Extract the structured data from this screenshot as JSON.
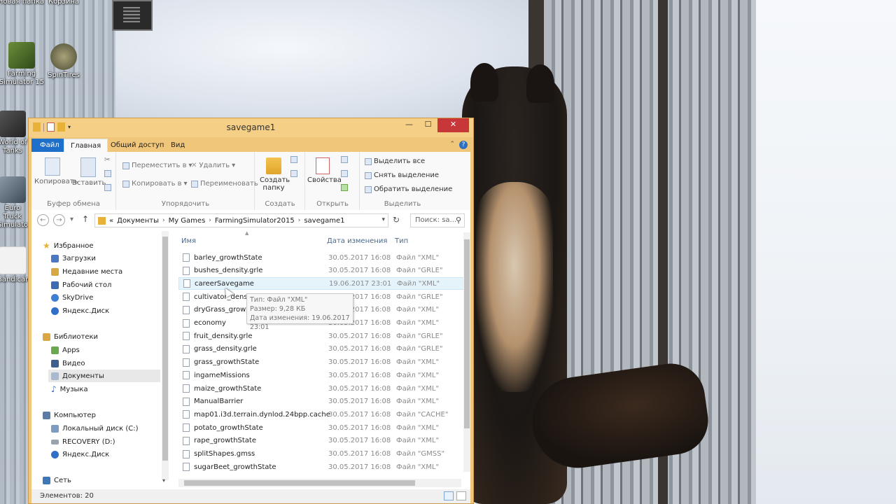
{
  "desktop": {
    "icons": [
      {
        "label": "Новая папка"
      },
      {
        "label": "Корзина"
      },
      {
        "label": "Farming Simulator 15"
      },
      {
        "label": "SpinTires"
      },
      {
        "label": "World of Tanks"
      },
      {
        "label": "Euro Truck Simulator"
      },
      {
        "label": "Bandicam"
      }
    ]
  },
  "window": {
    "title": "savegame1",
    "controls": {
      "minimize": "—",
      "maximize": "☐",
      "close": "✕"
    },
    "ribbon_tabs": [
      "Файл",
      "Главная",
      "Общий доступ",
      "Вид"
    ],
    "ribbon": {
      "clipboard": {
        "copy": "Копировать",
        "paste": "Вставить",
        "group": "Буфер обмена"
      },
      "organize": {
        "move_to": "Переместить в",
        "copy_to": "Копировать в",
        "delete": "Удалить",
        "rename": "Переименовать",
        "group": "Упорядочить"
      },
      "new": {
        "new_folder": "Создать папку",
        "group": "Создать"
      },
      "open": {
        "properties": "Свойства",
        "group": "Открыть"
      },
      "select": {
        "select_all": "Выделить все",
        "select_none": "Снять выделение",
        "invert": "Обратить выделение",
        "group": "Выделить"
      }
    },
    "address": {
      "crumbs": [
        "«",
        "Документы",
        "My Games",
        "FarmingSimulator2015",
        "savegame1"
      ],
      "search_placeholder": "Поиск: sa..."
    },
    "nav": {
      "favorites": "Избранное",
      "favorites_items": [
        "Загрузки",
        "Недавние места",
        "Рабочий стол",
        "SkyDrive",
        "Яндекс.Диск"
      ],
      "libraries": "Библиотеки",
      "libraries_items": [
        "Apps",
        "Видео",
        "Документы",
        "Музыка"
      ],
      "computer": "Компьютер",
      "computer_items": [
        "Локальный диск (C:)",
        "RECOVERY (D:)",
        "Яндекс.Диск"
      ],
      "network": "Сеть"
    },
    "columns": {
      "name": "Имя",
      "date": "Дата изменения",
      "type": "Тип"
    },
    "files": [
      {
        "name": "barley_growthState",
        "date": "30.05.2017 16:08",
        "type": "Файл \"XML\""
      },
      {
        "name": "bushes_density.grle",
        "date": "30.05.2017 16:08",
        "type": "Файл \"GRLE\""
      },
      {
        "name": "careerSavegame",
        "date": "19.06.2017 23:01",
        "type": "Файл \"XML\""
      },
      {
        "name": "cultivator_density.grle",
        "date": "30.05.2017 16:08",
        "type": "Файл \"GRLE\""
      },
      {
        "name": "dryGrass_growthState",
        "date": "30.05.2017 16:08",
        "type": "Файл \"XML\""
      },
      {
        "name": "economy",
        "date": "30.05.2017 16:08",
        "type": "Файл \"XML\""
      },
      {
        "name": "fruit_density.grle",
        "date": "30.05.2017 16:08",
        "type": "Файл \"GRLE\""
      },
      {
        "name": "grass_density.grle",
        "date": "30.05.2017 16:08",
        "type": "Файл \"GRLE\""
      },
      {
        "name": "grass_growthState",
        "date": "30.05.2017 16:08",
        "type": "Файл \"XML\""
      },
      {
        "name": "ingameMissions",
        "date": "30.05.2017 16:08",
        "type": "Файл \"XML\""
      },
      {
        "name": "maize_growthState",
        "date": "30.05.2017 16:08",
        "type": "Файл \"XML\""
      },
      {
        "name": "ManualBarrier",
        "date": "30.05.2017 16:08",
        "type": "Файл \"XML\""
      },
      {
        "name": "map01.i3d.terrain.dynlod.24bpp.cache",
        "date": "30.05.2017 16:08",
        "type": "Файл \"CACHE\""
      },
      {
        "name": "potato_growthState",
        "date": "30.05.2017 16:08",
        "type": "Файл \"XML\""
      },
      {
        "name": "rape_growthState",
        "date": "30.05.2017 16:08",
        "type": "Файл \"XML\""
      },
      {
        "name": "splitShapes.gmss",
        "date": "30.05.2017 16:08",
        "type": "Файл \"GMSS\""
      },
      {
        "name": "sugarBeet_growthState",
        "date": "30.05.2017 16:08",
        "type": "Файл \"XML\""
      }
    ],
    "tooltip": {
      "type": "Тип: Файл \"XML\"",
      "size": "Размер: 9,28 КБ",
      "modified": "Дата изменения: 19.06.2017 23:01"
    },
    "status": {
      "count": "Элементов: 20"
    }
  },
  "colors": {
    "titlebar": "#f5cf86",
    "file_tab": "#1e6fc9",
    "close": "#c7373a"
  }
}
